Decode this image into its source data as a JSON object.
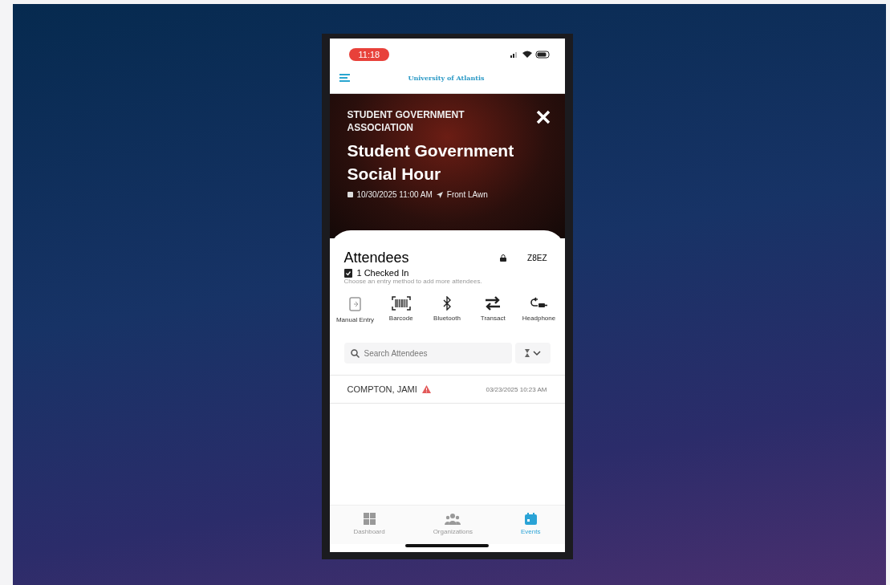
{
  "status_bar": {
    "time": "11:18"
  },
  "app_bar": {
    "logo": "University of Atlantis"
  },
  "event": {
    "organization": "STUDENT GOVERNMENT ASSOCIATION",
    "title": "Student Government Social Hour",
    "datetime": "10/30/2025 11:00 AM",
    "location": "Front LAwn"
  },
  "attendees": {
    "heading": "Attendees",
    "code": "Z8EZ",
    "checked_in": "1 Checked In",
    "hint": "Choose an entry method to add more attendees.",
    "entry_methods": [
      {
        "kind": "manual",
        "label": "Manual Entry"
      },
      {
        "kind": "barcode",
        "label": "Barcode"
      },
      {
        "kind": "bluetooth",
        "label": "Bluetooth"
      },
      {
        "kind": "transact",
        "label": "Transact"
      },
      {
        "kind": "headphone",
        "label": "Headphone"
      }
    ],
    "search": {
      "placeholder": "Search Attendees"
    },
    "rows": [
      {
        "name": "COMPTON, JAMI",
        "warning": true,
        "time": "03/23/2025 10:23 AM"
      }
    ]
  },
  "tab_bar": [
    {
      "kind": "dashboard",
      "label": "Dashboard",
      "selected": false
    },
    {
      "kind": "organizations",
      "label": "Organizations",
      "selected": false
    },
    {
      "kind": "events",
      "label": "Events",
      "selected": true
    }
  ]
}
